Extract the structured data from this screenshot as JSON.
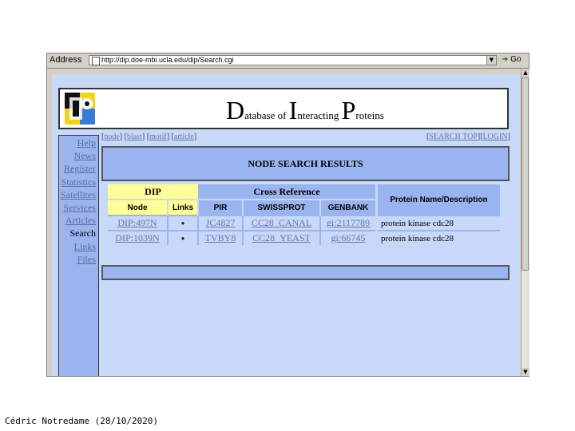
{
  "browser": {
    "address_label": "Address",
    "url": "http://dip.doe-mbi.ucla.edu/dip/Search.cgi",
    "go_label": "Go"
  },
  "banner": {
    "title": [
      {
        "big": "D",
        "small": "atabase of "
      },
      {
        "big": "I",
        "small": "nteracting "
      },
      {
        "big": "P",
        "small": "roteins"
      }
    ]
  },
  "sidebar": {
    "items": [
      {
        "label": "Help"
      },
      {
        "label": "News"
      },
      {
        "label": "Register"
      },
      {
        "label": "Statistics"
      },
      {
        "label": "Satellites"
      },
      {
        "label": "Services"
      },
      {
        "label": "Articles"
      },
      {
        "label": "Search"
      },
      {
        "label": "Links"
      },
      {
        "label": "Files"
      }
    ]
  },
  "top_links": {
    "left": [
      "node",
      "blast",
      "motif",
      "article"
    ],
    "right": [
      "SEARCH TOP",
      "LOGIN"
    ]
  },
  "results": {
    "title": "NODE SEARCH RESULTS",
    "group_headers": {
      "dip": "DIP",
      "cross": "Cross Reference",
      "protein": "Protein Name/Description"
    },
    "sub_headers": {
      "node": "Node",
      "links": "Links",
      "pir": "PIR",
      "swissprot": "SWISSPROT",
      "genbank": "GENBANK"
    },
    "rows": [
      {
        "node": "DIP:497N",
        "links": "●",
        "pir": "JC4827",
        "swissprot": "CC28_CANAL",
        "genbank": "gi:2117789",
        "protein": "protein kinase cdc28"
      },
      {
        "node": "DIP:1039N",
        "links": "●",
        "pir": "TVBY8",
        "swissprot": "CC28_YEAST",
        "genbank": "gi:66745",
        "protein": "protein kinase cdc28"
      }
    ]
  },
  "footer": {
    "text": "Cédric Notredame (28/10/2020)"
  },
  "colors": {
    "page_bg": "#c8d8f8",
    "accent_blue": "#9ab4f0",
    "dip_yellow": "#ffff99",
    "link": "#6677aa"
  }
}
